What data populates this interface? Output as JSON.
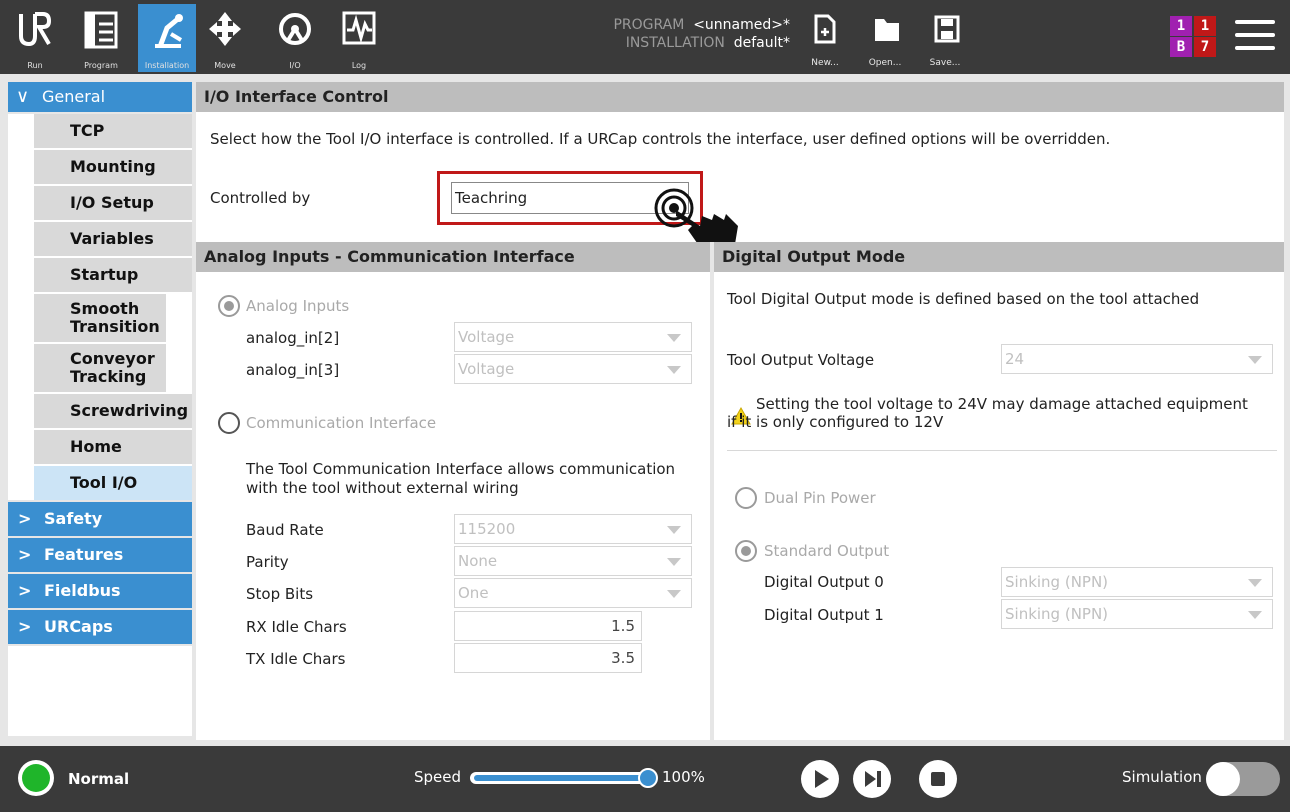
{
  "topbar": {
    "nav": [
      {
        "label": "Run",
        "icon": "ur-logo-icon"
      },
      {
        "label": "Program",
        "icon": "program-icon"
      },
      {
        "label": "Installation",
        "icon": "installation-icon"
      },
      {
        "label": "Move",
        "icon": "move-icon"
      },
      {
        "label": "I/O",
        "icon": "io-icon"
      },
      {
        "label": "Log",
        "icon": "log-icon"
      }
    ],
    "program_label": "PROGRAM",
    "program_value": "<unnamed>*",
    "installation_label": "INSTALLATION",
    "installation_value": "default*",
    "new_label": "New...",
    "open_label": "Open...",
    "save_label": "Save...",
    "badges": [
      "1",
      "1",
      "B",
      "7"
    ],
    "badge_colors": [
      "#a020b0",
      "#c01818",
      "#a020b0",
      "#c01818"
    ]
  },
  "sidebar": {
    "general": "General",
    "items": [
      "TCP",
      "Mounting",
      "I/O Setup",
      "Variables",
      "Startup",
      "Smooth Transition",
      "Conveyor Tracking",
      "Screwdriving",
      "Home",
      "Tool I/O"
    ],
    "categories": [
      "Safety",
      "Features",
      "Fieldbus",
      "URCaps"
    ]
  },
  "io_control": {
    "title": "I/O Interface Control",
    "description": "Select how the Tool I/O interface is controlled. If a URCap controls the interface, user defined options will be overridden.",
    "controlled_by_label": "Controlled by",
    "controlled_by_value": "Teachring"
  },
  "analog": {
    "title": "Analog Inputs - Communication Interface",
    "analog_inputs_label": "Analog Inputs",
    "in2_label": "analog_in[2]",
    "in2_value": "Voltage",
    "in3_label": "analog_in[3]",
    "in3_value": "Voltage",
    "comm_label": "Communication Interface",
    "comm_desc_1": "The Tool Communication Interface allows communication",
    "comm_desc_2": "with the tool without external wiring",
    "baud_label": "Baud Rate",
    "baud_value": "115200",
    "parity_label": "Parity",
    "parity_value": "None",
    "stop_label": "Stop Bits",
    "stop_value": "One",
    "rx_label": "RX Idle Chars",
    "rx_value": "1.5",
    "tx_label": "TX Idle Chars",
    "tx_value": "3.5"
  },
  "digital": {
    "title": "Digital Output Mode",
    "desc": "Tool Digital Output mode is defined based on the tool attached",
    "voltage_label": "Tool Output Voltage",
    "voltage_value": "24",
    "warning_1": "Setting the tool voltage to 24V may damage attached equipment",
    "warning_2": "if it is only configured to 12V",
    "dual_pin_label": "Dual Pin Power",
    "standard_label": "Standard Output",
    "do0_label": "Digital Output 0",
    "do0_value": "Sinking (NPN)",
    "do1_label": "Digital Output 1",
    "do1_value": "Sinking (NPN)"
  },
  "bottombar": {
    "status": "Normal",
    "speed_label": "Speed",
    "speed_value": "100%",
    "speed_level": 1.0,
    "simulation_label": "Simulation"
  }
}
